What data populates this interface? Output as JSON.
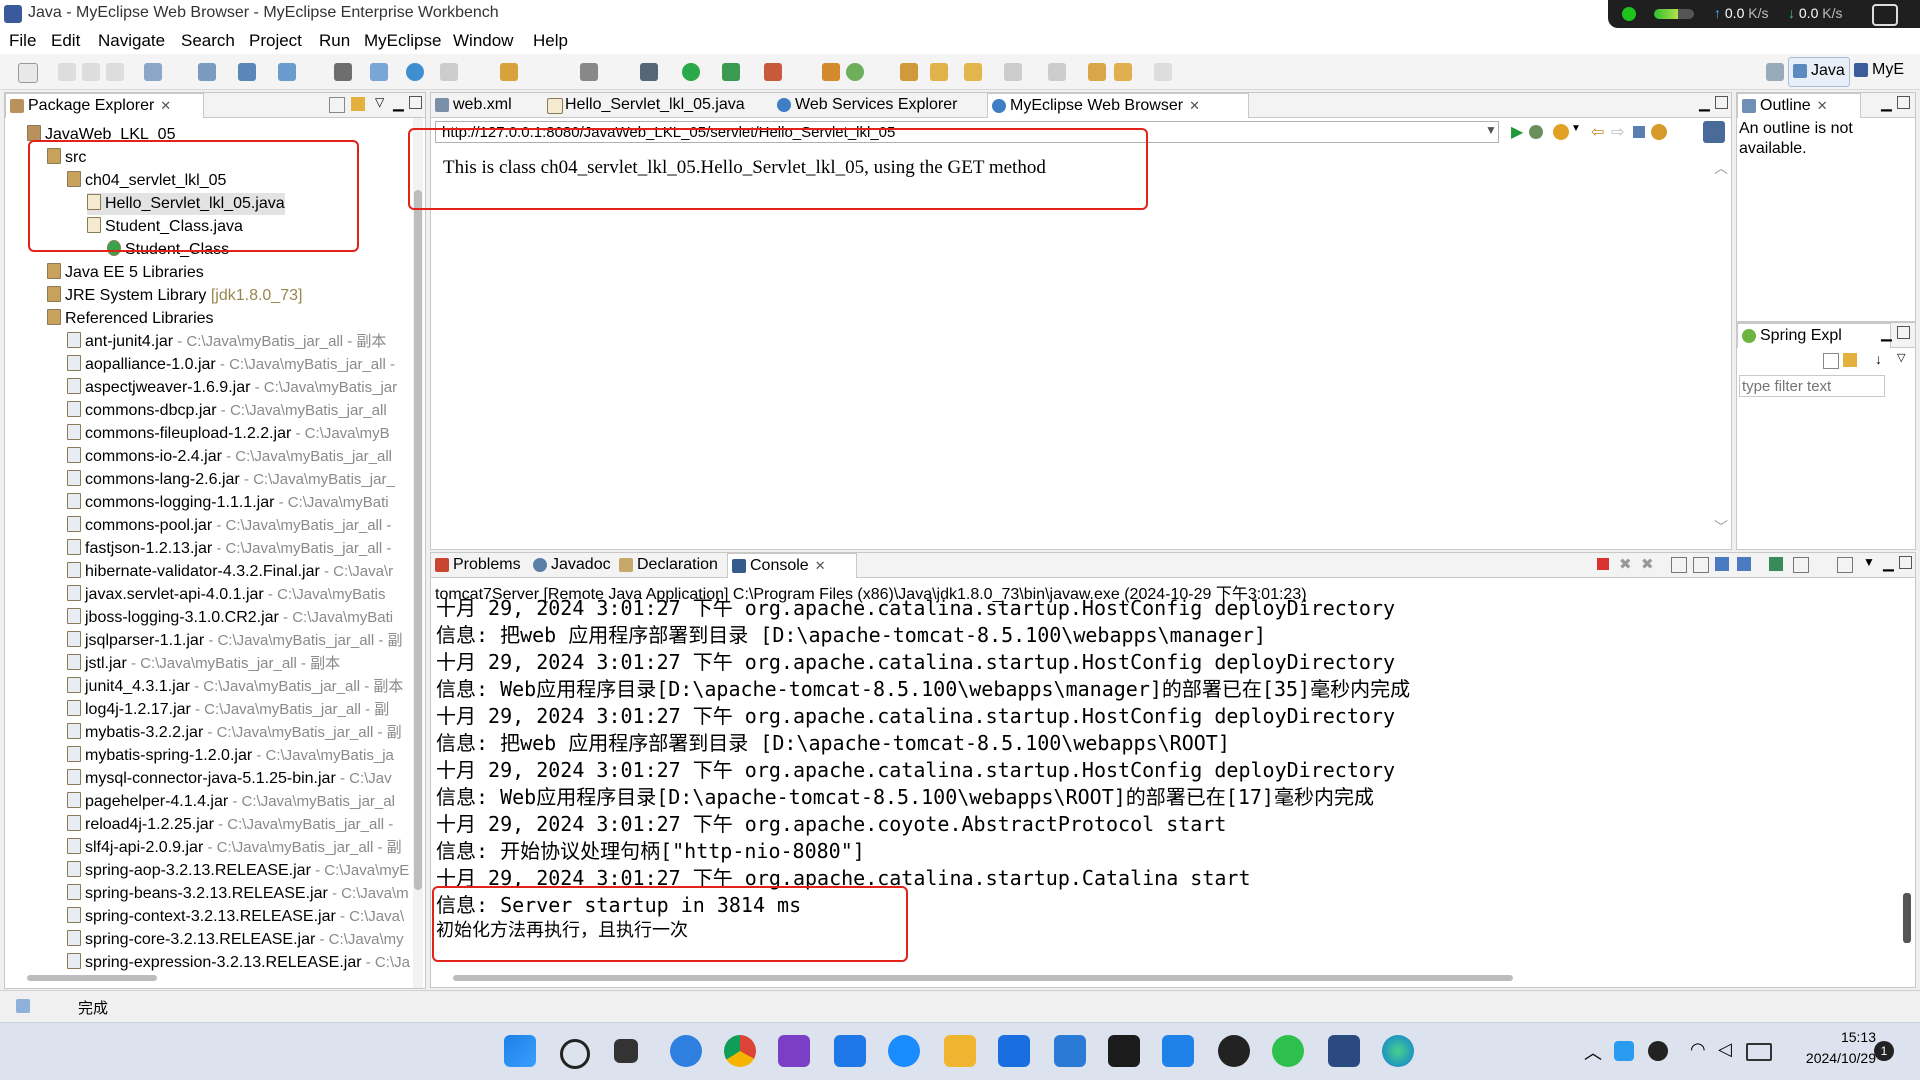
{
  "window": {
    "title": "Java - MyEclipse Web Browser - MyEclipse Enterprise Workbench"
  },
  "net_widget": {
    "up_value": "0.0",
    "down_value": "0.0",
    "unit": "K/s"
  },
  "menu": [
    "File",
    "Edit",
    "Navigate",
    "Search",
    "Project",
    "Run",
    "MyEclipse",
    "Window",
    "Help"
  ],
  "perspectives": [
    "Java",
    "MyE"
  ],
  "package_explorer": {
    "tab_label": "Package Explorer",
    "rows": [
      {
        "label": "JavaWeb_LKL_05",
        "path": ""
      },
      {
        "label": "src",
        "path": ""
      },
      {
        "label": "ch04_servlet_lkl_05",
        "path": ""
      },
      {
        "label": "Hello_Servlet_lkl_05.java",
        "path": ""
      },
      {
        "label": "Student_Class.java",
        "path": ""
      },
      {
        "label": "Student_Class",
        "path": ""
      },
      {
        "label": "Java EE 5 Libraries",
        "path": ""
      },
      {
        "label": "JRE System Library",
        "path": "[jdk1.8.0_73]"
      },
      {
        "label": "Referenced Libraries",
        "path": ""
      },
      {
        "label": "ant-junit4.jar",
        "path": " - C:\\Java\\myBatis_jar_all - 副本"
      },
      {
        "label": "aopalliance-1.0.jar",
        "path": " - C:\\Java\\myBatis_jar_all -"
      },
      {
        "label": "aspectjweaver-1.6.9.jar",
        "path": " - C:\\Java\\myBatis_jar"
      },
      {
        "label": "commons-dbcp.jar",
        "path": " - C:\\Java\\myBatis_jar_all"
      },
      {
        "label": "commons-fileupload-1.2.2.jar",
        "path": " - C:\\Java\\myB"
      },
      {
        "label": "commons-io-2.4.jar",
        "path": " - C:\\Java\\myBatis_jar_all"
      },
      {
        "label": "commons-lang-2.6.jar",
        "path": " - C:\\Java\\myBatis_jar_"
      },
      {
        "label": "commons-logging-1.1.1.jar",
        "path": " - C:\\Java\\myBati"
      },
      {
        "label": "commons-pool.jar",
        "path": " - C:\\Java\\myBatis_jar_all -"
      },
      {
        "label": "fastjson-1.2.13.jar",
        "path": " - C:\\Java\\myBatis_jar_all -"
      },
      {
        "label": "hibernate-validator-4.3.2.Final.jar",
        "path": " - C:\\Java\\r"
      },
      {
        "label": "javax.servlet-api-4.0.1.jar",
        "path": " - C:\\Java\\myBatis"
      },
      {
        "label": "jboss-logging-3.1.0.CR2.jar",
        "path": " - C:\\Java\\myBati"
      },
      {
        "label": "jsqlparser-1.1.jar",
        "path": " - C:\\Java\\myBatis_jar_all - 副"
      },
      {
        "label": "jstl.jar",
        "path": " - C:\\Java\\myBatis_jar_all - 副本"
      },
      {
        "label": "junit4_4.3.1.jar",
        "path": " - C:\\Java\\myBatis_jar_all - 副本"
      },
      {
        "label": "log4j-1.2.17.jar",
        "path": " - C:\\Java\\myBatis_jar_all - 副"
      },
      {
        "label": "mybatis-3.2.2.jar",
        "path": " - C:\\Java\\myBatis_jar_all - 副"
      },
      {
        "label": "mybatis-spring-1.2.0.jar",
        "path": " - C:\\Java\\myBatis_ja"
      },
      {
        "label": "mysql-connector-java-5.1.25-bin.jar",
        "path": " - C:\\Jav"
      },
      {
        "label": "pagehelper-4.1.4.jar",
        "path": " - C:\\Java\\myBatis_jar_al"
      },
      {
        "label": "reload4j-1.2.25.jar",
        "path": " - C:\\Java\\myBatis_jar_all -"
      },
      {
        "label": "slf4j-api-2.0.9.jar",
        "path": " - C:\\Java\\myBatis_jar_all - 副"
      },
      {
        "label": "spring-aop-3.2.13.RELEASE.jar",
        "path": " - C:\\Java\\myE"
      },
      {
        "label": "spring-beans-3.2.13.RELEASE.jar",
        "path": " - C:\\Java\\m"
      },
      {
        "label": "spring-context-3.2.13.RELEASE.jar",
        "path": " - C:\\Java\\"
      },
      {
        "label": "spring-core-3.2.13.RELEASE.jar",
        "path": " - C:\\Java\\my"
      },
      {
        "label": "spring-expression-3.2.13.RELEASE.jar",
        "path": " - C:\\Ja"
      }
    ]
  },
  "editor_tabs": [
    "web.xml",
    "Hello_Servlet_lkl_05.java",
    "Web Services Explorer",
    "MyEclipse Web Browser"
  ],
  "browser": {
    "url": "http://127.0.0.1:8080/JavaWeb_LKL_05/servlet/Hello_Servlet_lkl_05",
    "content": "This is class ch04_servlet_lkl_05.Hello_Servlet_lkl_05, using the GET method"
  },
  "outline": {
    "tab_label": "Outline",
    "message": "An outline is not available."
  },
  "spring": {
    "tab_label": "Spring Expl",
    "filter_placeholder": "type filter text"
  },
  "bottom_tabs": [
    "Problems",
    "Javadoc",
    "Declaration",
    "Console"
  ],
  "console": {
    "header": "tomcat7Server [Remote Java Application] C:\\Program Files (x86)\\Java\\jdk1.8.0_73\\bin\\javaw.exe (2024-10-29 下午3:01:23)",
    "lines": [
      {
        "t": "十月 29, 2024 3:01:27 下午 org.apache.catalina.startup.HostConfig deployDirectory",
        "cn": false
      },
      {
        "t": "信息: 把web 应用程序部署到目录 [D:\\apache-tomcat-8.5.100\\webapps\\manager]",
        "cn": false
      },
      {
        "t": "十月 29, 2024 3:01:27 下午 org.apache.catalina.startup.HostConfig deployDirectory",
        "cn": false
      },
      {
        "t": "信息: Web应用程序目录[D:\\apache-tomcat-8.5.100\\webapps\\manager]的部署已在[35]毫秒内完成",
        "cn": false
      },
      {
        "t": "十月 29, 2024 3:01:27 下午 org.apache.catalina.startup.HostConfig deployDirectory",
        "cn": false
      },
      {
        "t": "信息: 把web 应用程序部署到目录 [D:\\apache-tomcat-8.5.100\\webapps\\ROOT]",
        "cn": false
      },
      {
        "t": "十月 29, 2024 3:01:27 下午 org.apache.catalina.startup.HostConfig deployDirectory",
        "cn": false
      },
      {
        "t": "信息: Web应用程序目录[D:\\apache-tomcat-8.5.100\\webapps\\ROOT]的部署已在[17]毫秒内完成",
        "cn": false
      },
      {
        "t": "十月 29, 2024 3:01:27 下午 org.apache.coyote.AbstractProtocol start",
        "cn": false
      },
      {
        "t": "信息: 开始协议处理句柄[\"http-nio-8080\"]",
        "cn": false
      },
      {
        "t": "十月 29, 2024 3:01:27 下午 org.apache.catalina.startup.Catalina start",
        "cn": false
      },
      {
        "t": "信息: Server startup in 3814 ms",
        "cn": false
      },
      {
        "t": "初始化方法再执行，且执行一次",
        "cn": true
      }
    ]
  },
  "status": {
    "text": "完成"
  },
  "clock": {
    "time": "15:13",
    "date": "2024/10/29",
    "badge": "1"
  },
  "colors": {
    "highlight_box": "#e2231a",
    "taskbar_bg": "#dde3ee"
  }
}
